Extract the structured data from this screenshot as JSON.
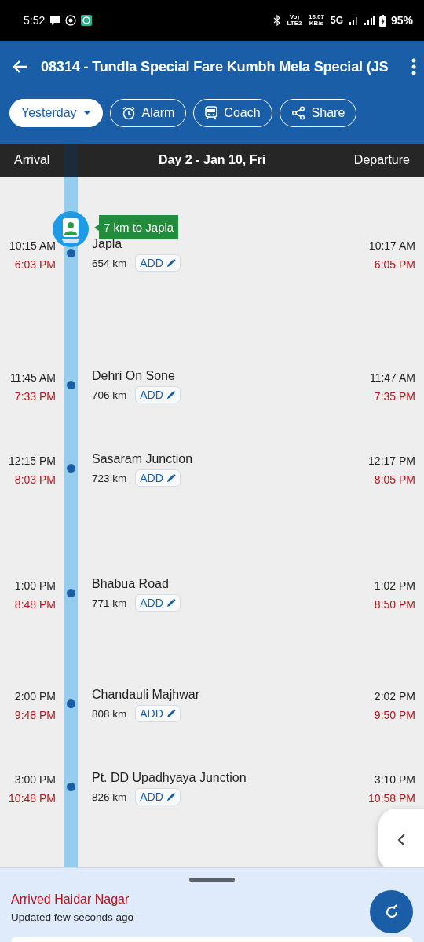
{
  "status_bar": {
    "time": "5:52",
    "network_label": "Vo) LTE2",
    "speed": "16.07 KB/s",
    "network_type": "5G",
    "battery": "95%"
  },
  "header": {
    "title": "08314 - Tundla Special Fare Kumbh Mela Special (JS",
    "chips": [
      {
        "kind": "dropdown",
        "label": "Yesterday",
        "selected": true
      },
      {
        "kind": "alarm",
        "label": "Alarm",
        "selected": false
      },
      {
        "kind": "coach",
        "label": "Coach",
        "selected": false
      },
      {
        "kind": "share",
        "label": "Share",
        "selected": false
      }
    ]
  },
  "columns": {
    "arrival": "Arrival",
    "day": "Day 2 - Jan 10, Fri",
    "departure": "Departure"
  },
  "stations": [
    {
      "name": "Japla",
      "distance": "654 km",
      "add": "ADD",
      "arrival_scheduled": "10:15 AM",
      "arrival_actual": "6:03 PM",
      "departure_scheduled": "10:17 AM",
      "departure_actual": "6:05 PM",
      "train_here": true,
      "train_label": "7 km to Japla"
    },
    {
      "name": "Dehri On Sone",
      "distance": "706 km",
      "add": "ADD",
      "arrival_scheduled": "11:45 AM",
      "arrival_actual": "7:33 PM",
      "departure_scheduled": "11:47 AM",
      "departure_actual": "7:35 PM",
      "train_here": false
    },
    {
      "name": "Sasaram Junction",
      "distance": "723 km",
      "add": "ADD",
      "arrival_scheduled": "12:15 PM",
      "arrival_actual": "8:03 PM",
      "departure_scheduled": "12:17 PM",
      "departure_actual": "8:05 PM",
      "train_here": false
    },
    {
      "name": "Bhabua Road",
      "distance": "771 km",
      "add": "ADD",
      "arrival_scheduled": "1:00 PM",
      "arrival_actual": "8:48 PM",
      "departure_scheduled": "1:02 PM",
      "departure_actual": "8:50 PM",
      "train_here": false
    },
    {
      "name": "Chandauli Majhwar",
      "distance": "808 km",
      "add": "ADD",
      "arrival_scheduled": "2:00 PM",
      "arrival_actual": "9:48 PM",
      "departure_scheduled": "2:02 PM",
      "departure_actual": "9:50 PM",
      "train_here": false
    },
    {
      "name": "Pt. DD Upadhyaya Junction",
      "distance": "826 km",
      "add": "ADD",
      "arrival_scheduled": "3:00 PM",
      "arrival_actual": "10:48 PM",
      "departure_scheduled": "3:10 PM",
      "departure_actual": "10:58 PM",
      "train_here": false
    }
  ],
  "bottom_sheet": {
    "status": "Arrived Haidar Nagar",
    "updated": "Updated few seconds ago"
  }
}
